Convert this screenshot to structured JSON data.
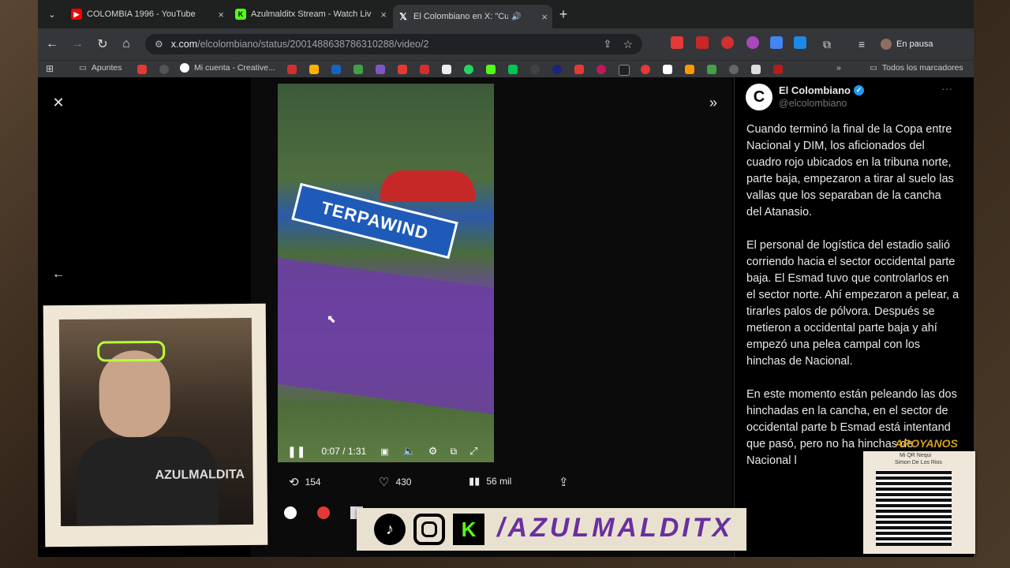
{
  "tabs": [
    {
      "label": "COLOMBIA 1996 - YouTube",
      "icon": "youtube-icon",
      "color": "#ff0000"
    },
    {
      "label": "Azulmalditx Stream - Watch Liv",
      "icon": "kick-icon",
      "color": "#53fc18"
    },
    {
      "label": "El Colombiano en X: \"Cuand",
      "icon": "x-icon",
      "color": "#ffffff"
    }
  ],
  "toolbar": {
    "url_host": "x.com",
    "url_path": "/elcolombiano/status/2001488638786310288/video/2",
    "profile_label": "En pausa"
  },
  "bookmarks": {
    "apuntes": "Apuntes",
    "mi_cuenta": "Mi cuenta - Creative...",
    "todos": "Todos los marcadores"
  },
  "video": {
    "time": "0:07 / 1:31"
  },
  "stats": {
    "reposts": "154",
    "likes": "430",
    "views": "56 mil"
  },
  "tweet": {
    "name": "El Colombiano",
    "handle": "@elcolombiano",
    "paragraphs": [
      "Cuando terminó la final de la Copa entre Nacional y DIM, los aficionados del cuadro rojo ubicados en la tribuna norte, parte baja, empezaron a tirar al suelo las vallas que los separaban de la cancha del Atanasio.",
      "El personal de logística del estadio salió corriendo hacia el sector occidental parte baja. El Esmad tuvo que controlarlos en el sector norte. Ahí empezaron a pelear, a tirarles palos de pólvora. Después se metieron a occidental parte baja y ahí empezó una pelea campal con los hinchas de Nacional.",
      "En este momento están peleando las dos hinchadas en la cancha, en el sector de occidental parte b Esmad está intentand que pasó, pero no ha hinchas de Nacional l"
    ]
  },
  "overlay": {
    "banner_text": "/AZULMALDITX",
    "qr_title": "AROYANOS",
    "qr_sub1": "Mi QR Nequi",
    "qr_sub2": "Simon De Los Rios",
    "webcam_caption": "AZULMALDITA"
  },
  "colors": {
    "accent": "#1d9bf0",
    "brand_kick": "#53fc18"
  }
}
